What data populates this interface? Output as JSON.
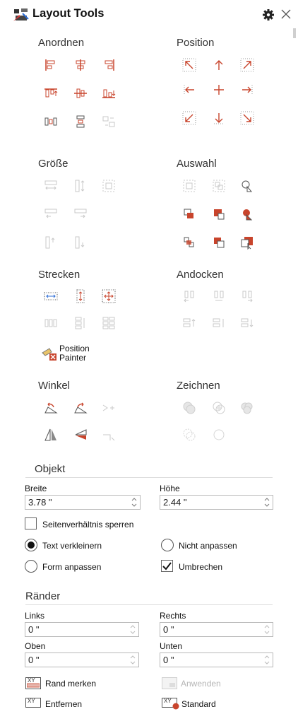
{
  "panel": {
    "title": "Layout Tools"
  },
  "sections": {
    "arrange": "Anordnen",
    "position": "Position",
    "size": "Größe",
    "selection": "Auswahl",
    "stretch": "Strecken",
    "dock": "Andocken",
    "angle": "Winkel",
    "draw": "Zeichnen",
    "object": "Objekt",
    "margins": "Ränder"
  },
  "position_painter": {
    "line1": "Position",
    "line2": "Painter"
  },
  "object": {
    "width_label": "Breite",
    "width_value": "3.78 \"",
    "height_label": "Höhe",
    "height_value": "2.44 \"",
    "lock_aspect_label": "Seitenverhältnis sperren",
    "lock_aspect_checked": false,
    "autofit_options": [
      {
        "label": "Text verkleinern",
        "selected": true
      },
      {
        "label": "Nicht anpassen",
        "selected": false
      },
      {
        "label": "Form anpassen",
        "selected": false
      }
    ],
    "wrap_label": "Umbrechen",
    "wrap_checked": true
  },
  "margins": {
    "left_label": "Links",
    "left_value": "0 \"",
    "right_label": "Rechts",
    "right_value": "0 \"",
    "top_label": "Oben",
    "top_value": "0 \"",
    "bottom_label": "Unten",
    "bottom_value": "0 \"",
    "remember_label": "Rand merken",
    "apply_label": "Anwenden",
    "remove_label": "Entfernen",
    "default_label": "Standard",
    "xy_badge": "XY"
  },
  "colors": {
    "accent": "#c8442c",
    "disabled": "#c9c9c9",
    "text": "#222222"
  }
}
